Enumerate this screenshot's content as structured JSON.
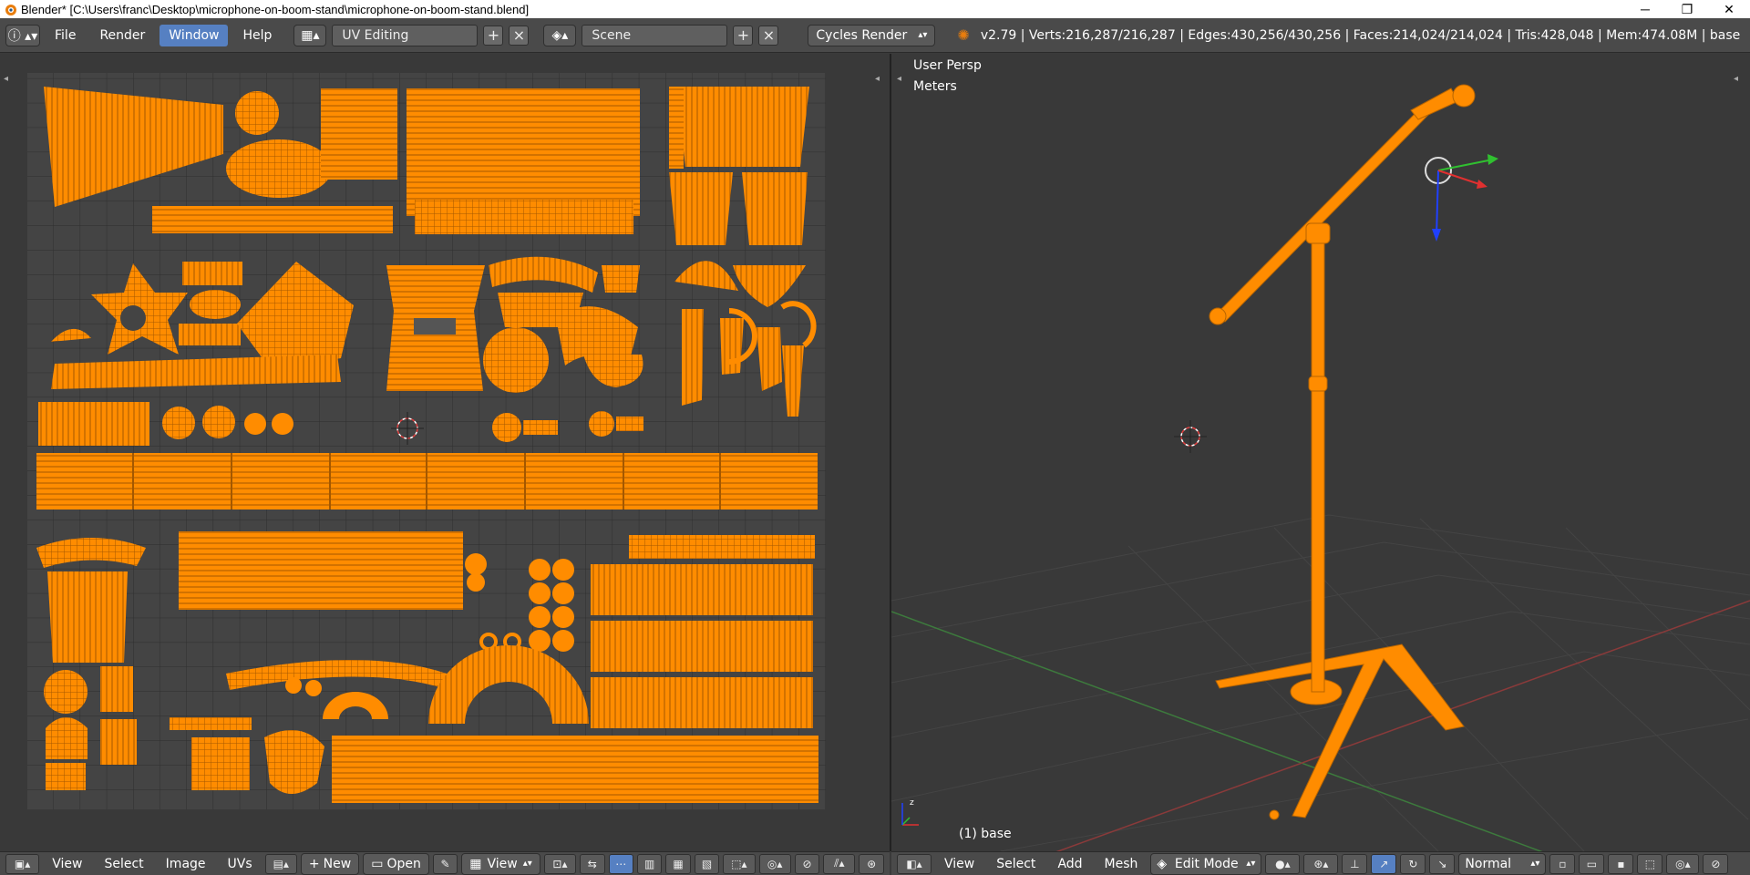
{
  "window": {
    "title": "Blender* [C:\\Users\\franc\\Desktop\\microphone-on-boom-stand\\microphone-on-boom-stand.blend]"
  },
  "infobar": {
    "menus": [
      "File",
      "Render",
      "Window",
      "Help"
    ],
    "active_menu": "Window",
    "screen_layout": "UV Editing",
    "scene": "Scene",
    "render_engine": "Cycles Render",
    "stats": "v2.79 | Verts:216,287/216,287 | Edges:430,256/430,256 | Faces:214,024/214,024 | Tris:428,048 | Mem:474.08M | base"
  },
  "uv_editor": {
    "header_menus": [
      "View",
      "Select",
      "Image",
      "UVs"
    ],
    "new_label": "New",
    "open_label": "Open",
    "view_label": "View"
  },
  "viewport": {
    "view_name": "User Persp",
    "units": "Meters",
    "object_label": "(1) base",
    "header_menus": [
      "View",
      "Select",
      "Add",
      "Mesh"
    ],
    "mode": "Edit Mode",
    "pivot": "Normal"
  },
  "colors": {
    "uv_orange": "#ff8c00",
    "active_blue": "#5680c2",
    "panel_bg": "#393939",
    "header_bg": "#4a4a4a"
  }
}
